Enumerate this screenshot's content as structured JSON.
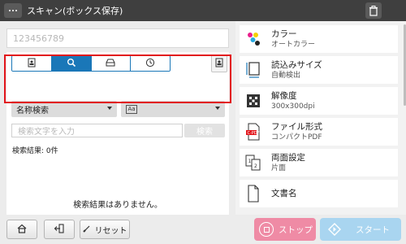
{
  "titlebar": {
    "title": "スキャン(ボックス保存)",
    "menu_icon": "ellipsis-icon",
    "right_icon": "trash-box-icon"
  },
  "left": {
    "box_number": "123456789",
    "tabs": [
      {
        "name": "tab-user-box",
        "icon": "user-box-icon"
      },
      {
        "name": "tab-search",
        "icon": "search-icon",
        "active": true
      },
      {
        "name": "tab-tray",
        "icon": "tray-icon"
      },
      {
        "name": "tab-history",
        "icon": "clock-icon"
      }
    ],
    "search_type_select": "名称検索",
    "charset_select_icon": "Aa",
    "keyword_placeholder": "検索文字を入力",
    "search_button": "検索",
    "result_count": "検索結果:  0件",
    "no_result": "検索結果はありません。"
  },
  "right": {
    "settings": [
      {
        "label": "カラー",
        "value": "オートカラー",
        "icon": "color-dots-icon"
      },
      {
        "label": "読込みサイズ",
        "value": "自動検出",
        "icon": "scan-size-icon"
      },
      {
        "label": "解像度",
        "value": "300x300dpi",
        "icon": "resolution-icon"
      },
      {
        "label": "ファイル形式",
        "value": "コンパクトPDF",
        "icon": "pdf-file-icon"
      },
      {
        "label": "両面設定",
        "value": "片面",
        "icon": "duplex-icon"
      },
      {
        "label": "文書名",
        "value": "",
        "icon": "document-icon"
      }
    ]
  },
  "footer": {
    "reset_label": "リセット",
    "stop_label": "ストップ",
    "start_label": "スタート"
  },
  "colors": {
    "titlebar": "#3f3f3f",
    "accent_blue": "#1a77b8",
    "highlight_red": "#e2151b",
    "stop_pink": "#ef8ba5",
    "start_blue": "#a9d5f0"
  }
}
